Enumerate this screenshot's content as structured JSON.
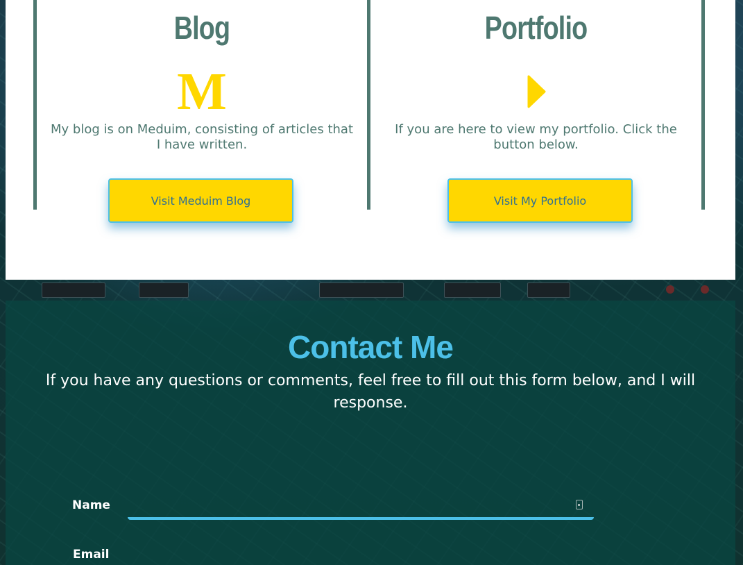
{
  "blog": {
    "title": "Blog",
    "icon": "medium-icon",
    "icon_glyph": "M",
    "description": "My blog is on Meduim, consisting of articles that I have written.",
    "button_label": "Visit Meduim Blog"
  },
  "portfolio": {
    "title": "Portfolio",
    "icon": "play-icon",
    "description": "If you are here to view my portfolio. Click the button below.",
    "button_label": "Visit My Portfolio"
  },
  "contact": {
    "title": "Contact Me",
    "description": "If you have any questions or comments, feel free to fill out this form below, and I will response.",
    "fields": [
      {
        "label": "Name",
        "value": "",
        "icon": "contact-card-icon"
      },
      {
        "label": "Email"
      }
    ]
  },
  "colors": {
    "accent_teal": "#4e7870",
    "accent_yellow": "#ffd700",
    "accent_blue": "#4cc0e8"
  }
}
